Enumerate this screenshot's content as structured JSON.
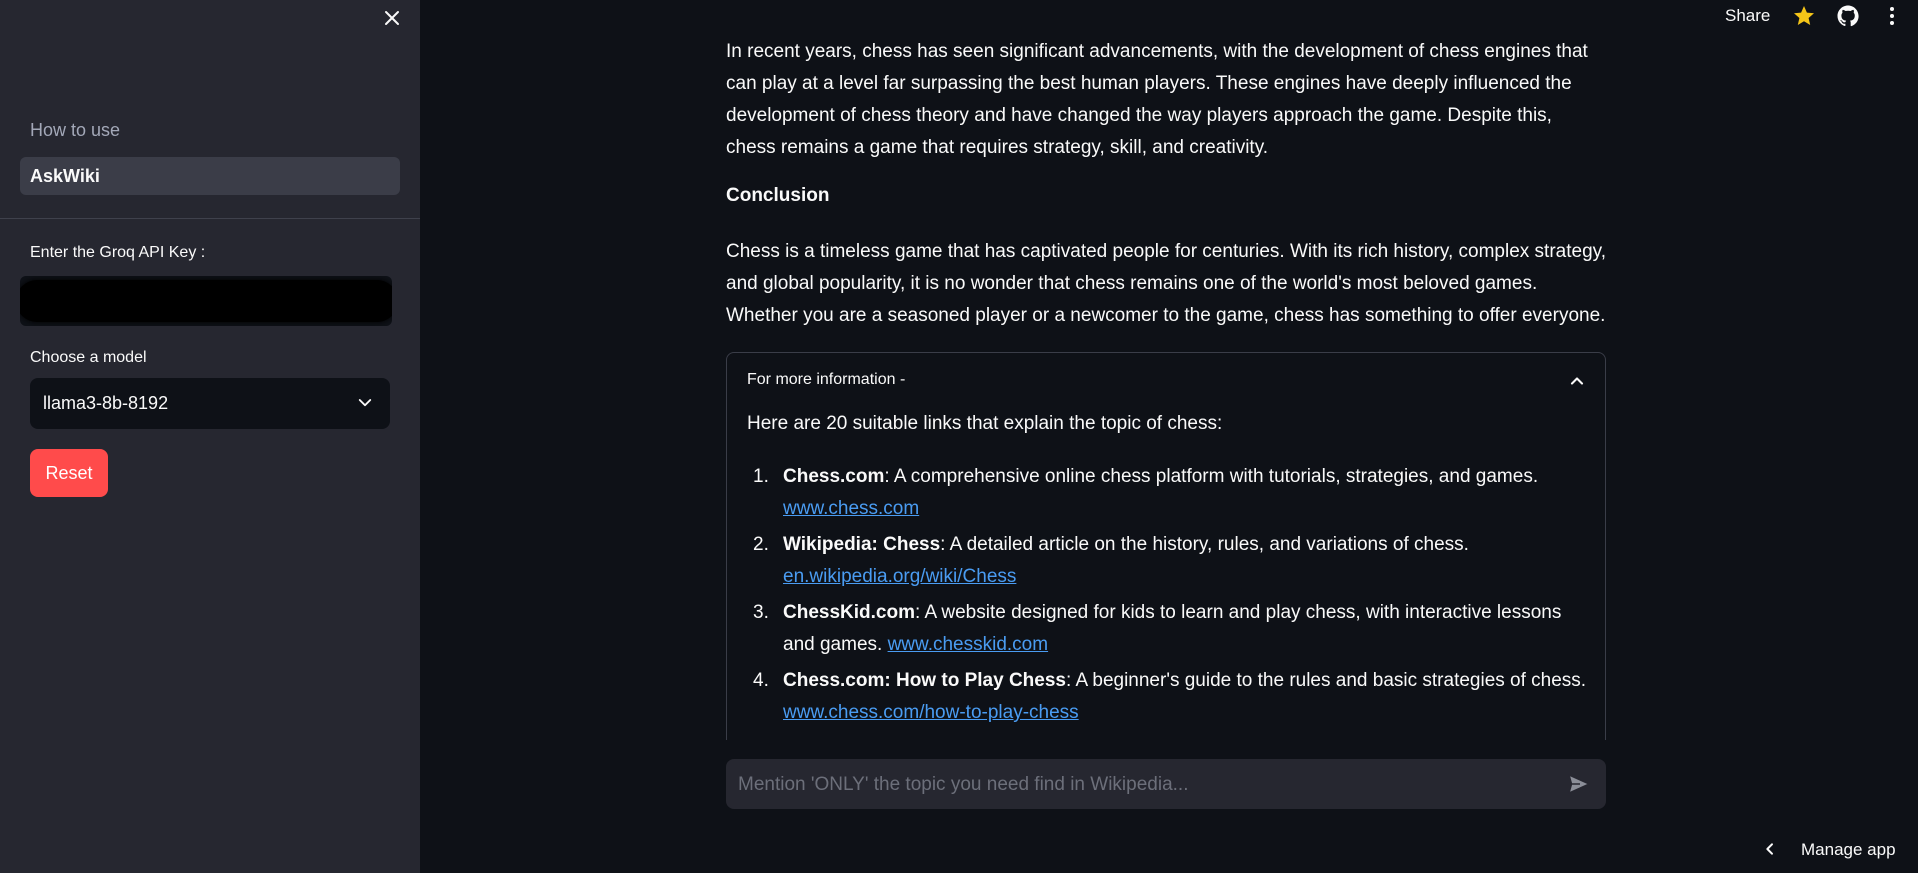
{
  "sidebar": {
    "how_to_use": "How to use",
    "app_name": "AskWiki",
    "api_key_label": "Enter the Groq API Key :",
    "model_label": "Choose a model",
    "model_selected": "llama3-8b-8192",
    "reset_label": "Reset"
  },
  "header": {
    "share_label": "Share",
    "icons": [
      "star-icon",
      "github-icon",
      "more-vertical-icon"
    ]
  },
  "main": {
    "paragraph1": "In recent years, chess has seen significant advancements, with the development of chess engines that can play at a level far surpassing the best human players. These engines have deeply influenced the development of chess theory and have changed the way players approach the game. Despite this, chess remains a game that requires strategy, skill, and creativity.",
    "conclusion_heading": "Conclusion",
    "paragraph2": "Chess is a timeless game that has captivated people for centuries. With its rich history, complex strategy, and global popularity, it is no wonder that chess remains one of the world's most beloved games. Whether you are a seasoned player or a newcomer to the game, chess has something to offer everyone.",
    "expander": {
      "title": "For more information -",
      "intro": "Here are 20 suitable links that explain the topic of chess:",
      "items": [
        {
          "num": "1.",
          "bold": "Chess.com",
          "text": ": A comprehensive online chess platform with tutorials, strategies, and games. ",
          "link": "www.chess.com"
        },
        {
          "num": "2.",
          "bold": "Wikipedia: Chess",
          "text": ": A detailed article on the history, rules, and variations of chess. ",
          "link": "en.wikipedia.org/wiki/Chess"
        },
        {
          "num": "3.",
          "bold": "ChessKid.com",
          "text": ": A website designed for kids to learn and play chess, with interactive lessons and games. ",
          "link": "www.chesskid.com"
        },
        {
          "num": "4.",
          "bold": "Chess.com: How to Play Chess",
          "text": ": A beginner's guide to the rules and basic strategies of chess. ",
          "link": "www.chess.com/how-to-play-chess"
        }
      ]
    }
  },
  "chat": {
    "placeholder": "Mention 'ONLY' the topic you need find in Wikipedia..."
  },
  "footer": {
    "manage_app": "Manage app"
  },
  "colors": {
    "background": "#0e1117",
    "sidebar": "#262730",
    "accent": "#ff4b4b",
    "link": "#4a9cf2",
    "star": "#f5c518"
  }
}
